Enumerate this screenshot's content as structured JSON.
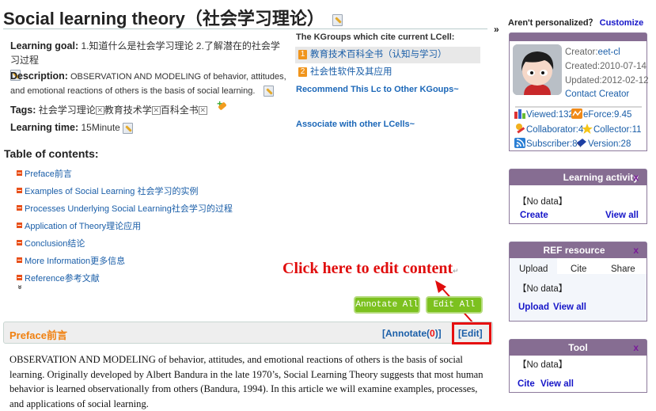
{
  "page": {
    "title": "Social learning theory（社会学习理论）",
    "icons": {
      "edit": "edit-pencil-icon",
      "tag_remove": "tag-remove-icon",
      "tag_add": "add-tag-icon"
    }
  },
  "info": {
    "goal_label": "Learning goal:",
    "goal_value": "1.知道什么是社会学习理论 2.了解潜在的社会学习过程",
    "desc_label": "Description:",
    "desc_value": "OBSERVATION AND MODELING of behavior, attitudes, and emotional reactions of others is the basis of social learning.",
    "tags_label": "Tags:",
    "tags": [
      "社会学习理论",
      "教育技术学",
      "百科全书"
    ],
    "time_label": "Learning time:",
    "time_value": "15Minute"
  },
  "kgroups": {
    "title": "The KGroups which cite current LCell:",
    "items": [
      {
        "num": "1",
        "label": "教育技术百科全书（认知与学习）"
      },
      {
        "num": "2",
        "label": "社会性软件及其应用"
      }
    ],
    "recommend": "Recommend This Lc to Other KGoups~",
    "associate": "Associate with other LCells~"
  },
  "toc": {
    "title": "Table of contents:",
    "items": [
      "Preface前言",
      "Examples of Social Learning 社会学习的实例",
      "Processes Underlying Social Learning社会学习的过程",
      "Application of Theory理论应用",
      "Conclusion结论",
      "More Information更多信息",
      "Reference参考文献"
    ],
    "more_glyph": "»"
  },
  "annotation": {
    "callout": "Click here to edit content",
    "return_mark": "↵",
    "color": "#e00d0d"
  },
  "buttons": {
    "annotate_all": "Annotate All",
    "edit_all": "Edit All"
  },
  "section": {
    "title": "Preface前言",
    "annotate_prefix": "[Annotate(",
    "annotate_count": "0",
    "annotate_suffix": ")]",
    "edit": "[Edit]",
    "body": "OBSERVATION AND MODELING of behavior, attitudes, and emotional reactions of others is the basis of social learning. Originally developed by Albert Bandura in the late 1970’s, Social Learning Theory suggests that most human behavior is learned observationally from others (Bandura, 1994). In this article we will examine examples, processes, and applications of social learning."
  },
  "sidebar": {
    "collapse_glyph": "»",
    "personalize_text": "Aren't personalized？",
    "customize": "Customize",
    "creator": {
      "creator_label": "Creator:",
      "creator_name": "eet-cl",
      "created": "Created:2010-07-14",
      "updated": "Updated:2012-02-12",
      "contact": "Contact Creator",
      "stats": {
        "viewed": "Viewed:132",
        "eforce": "eForce:9.45",
        "collaborator": "Collaborator:4",
        "collector": "Collector:11",
        "subscriber": "Subscriber:8",
        "version": "Version:28"
      }
    },
    "learning_activity": {
      "title": "Learning activity",
      "close": "x",
      "nodata": "【No data】",
      "create": "Create",
      "view_all": "View all"
    },
    "ref_resource": {
      "title": "REF resource",
      "close": "x",
      "tabs": [
        "Upload",
        "Cite",
        "Share"
      ],
      "nodata": "【No data】",
      "upload": "Upload",
      "view_all": "View all"
    },
    "tool": {
      "title": "Tool",
      "close": "x",
      "nodata": "【No data】",
      "cite": "Cite",
      "view_all": "View all"
    }
  }
}
